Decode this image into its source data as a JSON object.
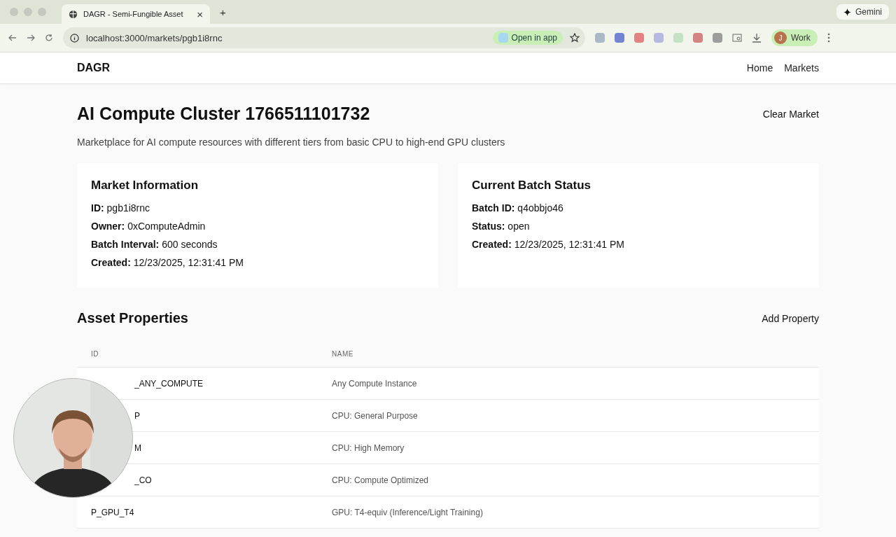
{
  "browser": {
    "tab": {
      "title": "DAGR - Semi-Fungible Asset",
      "close": "×"
    },
    "new_tab": "+",
    "gemini": "Gemini",
    "url": "localhost:3000/markets/pgb1i8rnc",
    "open_in_app": "Open in app",
    "profile": {
      "initial": "J",
      "label": "Work"
    }
  },
  "nav": {
    "brand": "DAGR",
    "links": [
      "Home",
      "Markets"
    ]
  },
  "header": {
    "title": "AI Compute Cluster 1766511101732",
    "action": "Clear Market",
    "description": "Marketplace for AI compute resources with different tiers from basic CPU to high-end GPU clusters"
  },
  "cards": [
    {
      "title": "Market Information",
      "fields": [
        {
          "label": "ID:",
          "value": "pgb1i8rnc"
        },
        {
          "label": "Owner:",
          "value": "0xComputeAdmin"
        },
        {
          "label": "Batch Interval:",
          "value": "600 seconds"
        },
        {
          "label": "Created:",
          "value": "12/23/2025, 12:31:41 PM"
        }
      ]
    },
    {
      "title": "Current Batch Status",
      "fields": [
        {
          "label": "Batch ID:",
          "value": "q4obbjo46"
        },
        {
          "label": "Status:",
          "value": "open"
        },
        {
          "label": "Created:",
          "value": "12/23/2025, 12:31:41 PM"
        }
      ]
    }
  ],
  "properties": {
    "title": "Asset Properties",
    "action": "Add Property",
    "columns": [
      "ID",
      "NAME"
    ],
    "rows": [
      {
        "id": "_ANY_COMPUTE",
        "kind": "partial",
        "name": "Any Compute Instance"
      },
      {
        "id": "P",
        "kind": "partial",
        "name": "CPU: General Purpose"
      },
      {
        "id": "M",
        "kind": "partial",
        "name": "CPU: High Memory"
      },
      {
        "id": "_CO",
        "kind": "partial",
        "name": "CPU: Compute Optimized"
      },
      {
        "id": "P_GPU_T4",
        "kind": "full",
        "name": "GPU: T4-equiv (Inference/Light Training)"
      }
    ]
  }
}
